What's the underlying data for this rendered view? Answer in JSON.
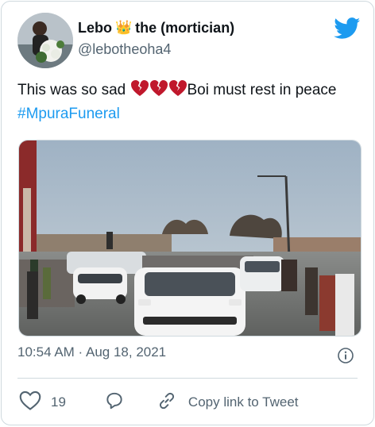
{
  "author": {
    "name_part1": "Lebo",
    "crown_emoji": "👑",
    "name_part2": "the (mortician)",
    "handle": "@lebotheoha4"
  },
  "tweet": {
    "text_before": "This was so sad ",
    "broken_hearts": [
      "💔",
      "💔",
      "💔"
    ],
    "text_after": "Boi must rest in peace ",
    "hashtag": "#MpuraFuneral"
  },
  "meta": {
    "timestamp": "10:54 AM · Aug 18, 2021"
  },
  "actions": {
    "like_count": "19",
    "copy_link_label": "Copy link to Tweet"
  },
  "icons": {
    "brand": "twitter-bird-icon",
    "like": "heart-icon",
    "reply": "reply-bubble-icon",
    "copy": "link-icon",
    "info": "info-icon"
  },
  "colors": {
    "brand": "#1d9bf0",
    "heart": "#c0182c",
    "text": "#0f1419",
    "secondary": "#536471"
  }
}
